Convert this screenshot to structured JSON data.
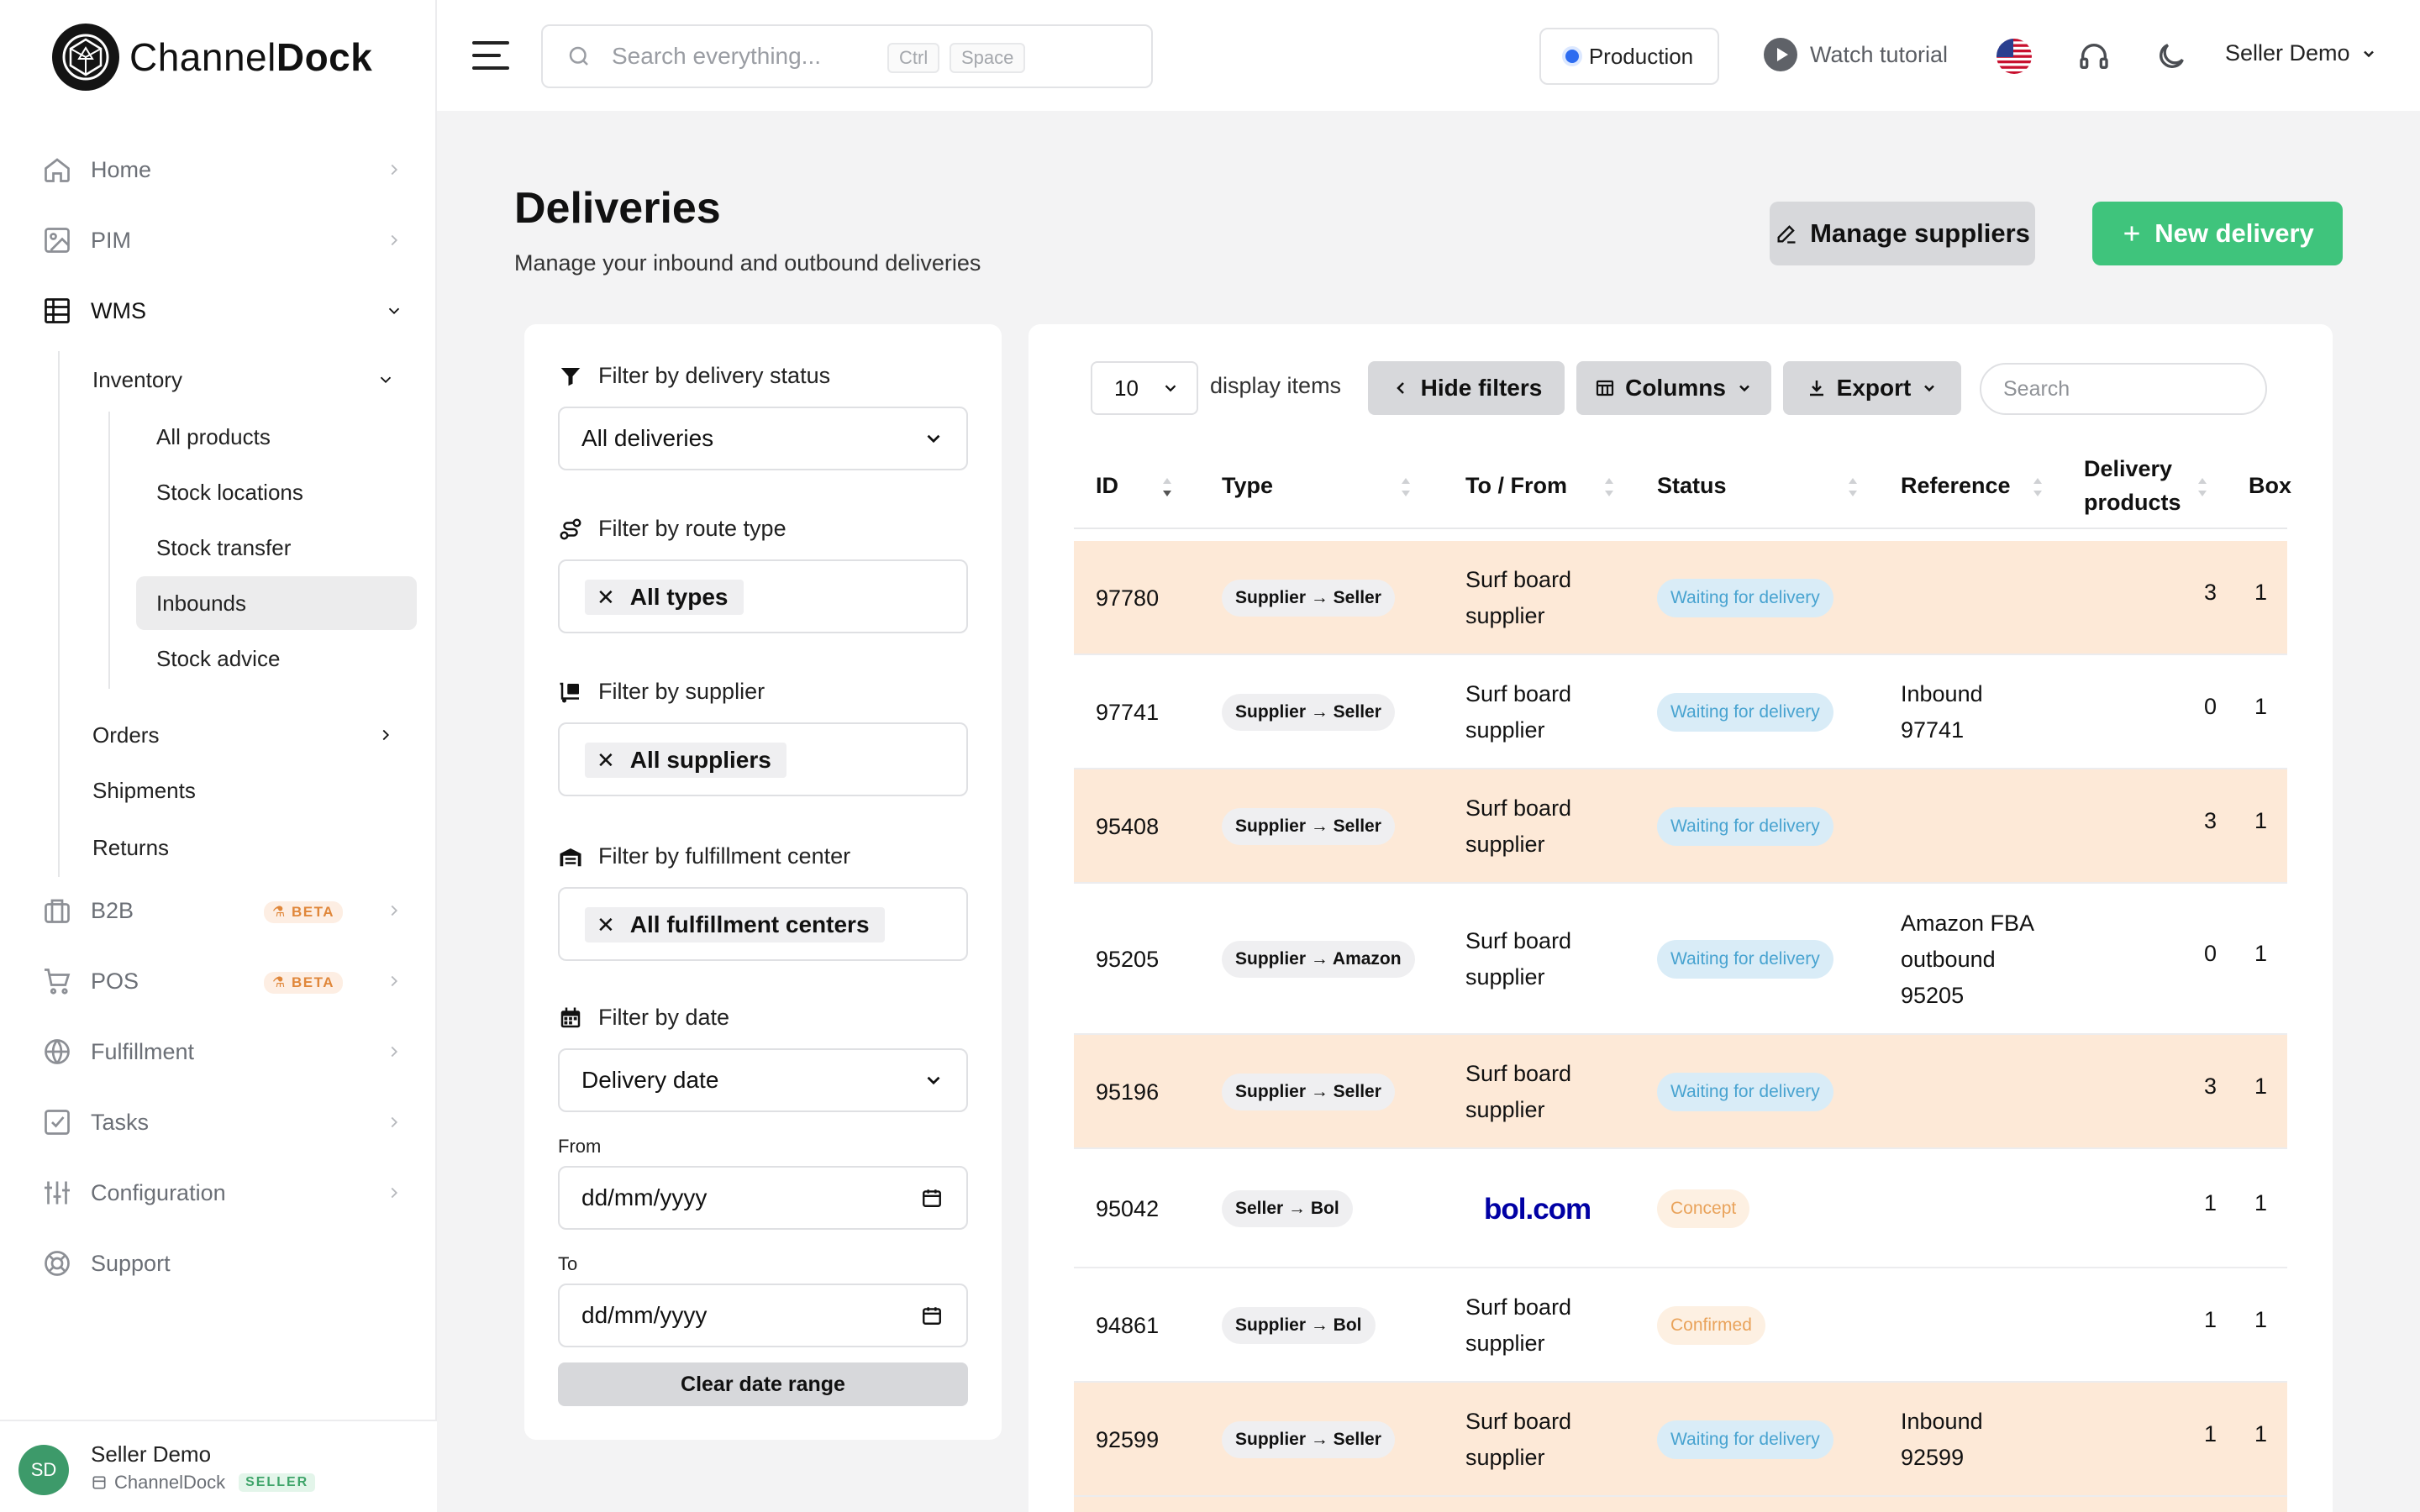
{
  "app": {
    "logo_light": "Channel",
    "logo_bold": "Dock"
  },
  "topbar": {
    "search_placeholder": "Search everything...",
    "kbd1": "Ctrl",
    "kbd2": "Space",
    "environment": "Production",
    "tutorial": "Watch tutorial",
    "user": "Seller Demo"
  },
  "sidebar": {
    "items": [
      {
        "label": "Home",
        "icon": "home-icon"
      },
      {
        "label": "PIM",
        "icon": "image-icon"
      },
      {
        "label": "WMS",
        "icon": "table-icon"
      },
      {
        "label": "B2B",
        "icon": "briefcase-icon",
        "badge": "BETA"
      },
      {
        "label": "POS",
        "icon": "cart-icon",
        "badge": "BETA"
      },
      {
        "label": "Fulfillment",
        "icon": "globe-icon"
      },
      {
        "label": "Tasks",
        "icon": "checkbox-icon"
      },
      {
        "label": "Configuration",
        "icon": "sliders-icon"
      },
      {
        "label": "Support",
        "icon": "lifebuoy-icon"
      }
    ],
    "wms_sub": {
      "inventory": "Inventory",
      "inventory_items": [
        "All products",
        "Stock locations",
        "Stock transfer",
        "Inbounds",
        "Stock advice"
      ],
      "orders": "Orders",
      "shipments": "Shipments",
      "returns": "Returns"
    },
    "footer": {
      "initials": "SD",
      "name": "Seller Demo",
      "org": "ChannelDock",
      "role": "SELLER"
    }
  },
  "page": {
    "title": "Deliveries",
    "subtitle": "Manage your inbound and outbound deliveries",
    "manage_suppliers": "Manage suppliers",
    "new_delivery": "New delivery"
  },
  "filters": {
    "status_label": "Filter by delivery status",
    "status_value": "All deliveries",
    "route_label": "Filter by route type",
    "route_chip": "All types",
    "supplier_label": "Filter by supplier",
    "supplier_chip": "All suppliers",
    "fc_label": "Filter by fulfillment center",
    "fc_chip": "All fulfillment centers",
    "date_label": "Filter by date",
    "date_value": "Delivery date",
    "from_label": "From",
    "from_placeholder": "dd/mm/yyyy",
    "to_label": "To",
    "to_placeholder": "dd/mm/yyyy",
    "clear": "Clear date range"
  },
  "table": {
    "per_page": "10",
    "display_items": "display items",
    "hide_filters": "Hide filters",
    "columns": "Columns",
    "export": "Export",
    "search_placeholder": "Search",
    "headers": {
      "id": "ID",
      "type": "Type",
      "to_from": "To / From",
      "status": "Status",
      "reference": "Reference",
      "delivery_products_1": "Delivery",
      "delivery_products_2": "products",
      "box": "Box"
    },
    "rows": [
      {
        "id": "97780",
        "type": "Supplier → Seller",
        "to1": "Surf board",
        "to2": "supplier",
        "status": "Waiting for delivery",
        "ref1": "",
        "ref2": "",
        "ref3": "",
        "products": "3",
        "box": "1",
        "highlight": true
      },
      {
        "id": "97741",
        "type": "Supplier → Seller",
        "to1": "Surf board",
        "to2": "supplier",
        "status": "Waiting for delivery",
        "ref1": "Inbound",
        "ref2": "97741",
        "ref3": "",
        "products": "0",
        "box": "1",
        "highlight": false
      },
      {
        "id": "95408",
        "type": "Supplier → Seller",
        "to1": "Surf board",
        "to2": "supplier",
        "status": "Waiting for delivery",
        "ref1": "",
        "ref2": "",
        "ref3": "",
        "products": "3",
        "box": "1",
        "highlight": true
      },
      {
        "id": "95205",
        "type": "Supplier → Amazon",
        "to1": "Surf board",
        "to2": "supplier",
        "status": "Waiting for delivery",
        "ref1": "Amazon FBA",
        "ref2": "outbound",
        "ref3": "95205",
        "products": "0",
        "box": "1",
        "highlight": false
      },
      {
        "id": "95196",
        "type": "Supplier → Seller",
        "to1": "Surf board",
        "to2": "supplier",
        "status": "Waiting for delivery",
        "ref1": "",
        "ref2": "",
        "ref3": "",
        "products": "3",
        "box": "1",
        "highlight": true
      },
      {
        "id": "95042",
        "type": "Seller → Bol",
        "logo": "bol.com",
        "status": "Concept",
        "ref1": "",
        "ref2": "",
        "ref3": "",
        "products": "1",
        "box": "1",
        "highlight": false
      },
      {
        "id": "94861",
        "type": "Supplier → Bol",
        "to1": "Surf board",
        "to2": "supplier",
        "status": "Confirmed",
        "ref1": "",
        "ref2": "",
        "ref3": "",
        "products": "1",
        "box": "1",
        "highlight": false
      },
      {
        "id": "92599",
        "type": "Supplier → Seller",
        "to1": "Surf board",
        "to2": "supplier",
        "status": "Waiting for delivery",
        "ref1": "Inbound",
        "ref2": "92599",
        "ref3": "",
        "products": "1",
        "box": "1",
        "highlight": true
      }
    ]
  },
  "colors": {
    "accent": "#3fc47c",
    "row_highlight": "#fde9d7",
    "waiting": "#48a3d0",
    "concept": "#e9a35b",
    "bol": "#0000a4"
  }
}
